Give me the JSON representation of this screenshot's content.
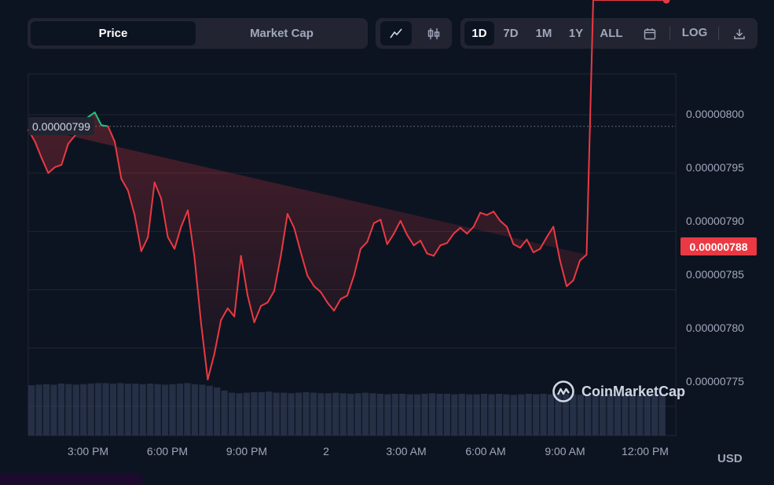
{
  "toolbar": {
    "price_label": "Price",
    "market_cap_label": "Market Cap",
    "line_icon": "line-chart-icon",
    "candle_icon": "candlestick-icon",
    "periods": [
      "1D",
      "7D",
      "1M",
      "1Y",
      "ALL"
    ],
    "active_period": "1D",
    "calendar_icon": "calendar-icon",
    "log_label": "LOG",
    "download_icon": "download-icon"
  },
  "chart_data": {
    "type": "area",
    "x_tick_labels": [
      "3:00 PM",
      "6:00 PM",
      "9:00 PM",
      "2",
      "3:00 AM",
      "6:00 AM",
      "9:00 AM",
      "12:00 PM"
    ],
    "y_tick_labels": [
      "0.00000800",
      "0.00000795",
      "0.00000790",
      "0.00000785",
      "0.00000780",
      "0.00000775"
    ],
    "ylim": [
      7.725e-06,
      8.035e-06
    ],
    "start_price": 7.99e-06,
    "start_price_label": "0.00000799",
    "current_price": 7.88e-06,
    "current_price_label": "0.00000788",
    "currency": "USD",
    "colors": {
      "down": "#ea3943",
      "up": "#16c784",
      "volume": "#3a4564"
    },
    "series": [
      {
        "x_hours": [
          0,
          0.25,
          0.5,
          0.75,
          1,
          1.25,
          1.5,
          1.75,
          2,
          2.25,
          2.5,
          2.75,
          3,
          3.25,
          3.5,
          3.75,
          4,
          4.25,
          4.5,
          4.75,
          5,
          5.25,
          5.5,
          5.75,
          6,
          6.25,
          6.5,
          6.75,
          7,
          7.25,
          7.5,
          7.75,
          8,
          8.25,
          8.5,
          8.75,
          9,
          9.25,
          9.5,
          9.75,
          10,
          10.25,
          10.5,
          10.75,
          11,
          11.25,
          11.5,
          11.75,
          12,
          12.25,
          12.5,
          12.75,
          13,
          13.25,
          13.5,
          13.75,
          14,
          14.25,
          14.5,
          14.75,
          15,
          15.25,
          15.5,
          15.75,
          16,
          16.25,
          16.5,
          16.75,
          17,
          17.25,
          17.5,
          17.75,
          18,
          18.25,
          18.5,
          18.75,
          19,
          19.25,
          19.5,
          19.75,
          20,
          20.25,
          20.5,
          20.75,
          21,
          21.25,
          21.5,
          21.75,
          22,
          22.25,
          22.5,
          22.75,
          23,
          23.25,
          23.5,
          23.75,
          24
        ],
        "values": [
          7.987e-06,
          7.977e-06,
          7.963e-06,
          7.95e-06,
          7.955e-06,
          7.957e-06,
          7.975e-06,
          7.982e-06,
          7.988e-06,
          7.998e-06,
          8.002e-06,
          7.991e-06,
          7.99e-06,
          7.977e-06,
          7.945e-06,
          7.935e-06,
          7.914e-06,
          7.883e-06,
          7.895e-06,
          7.942e-06,
          7.928e-06,
          7.895e-06,
          7.885e-06,
          7.904e-06,
          7.918e-06,
          7.878e-06,
          7.821e-06,
          7.773e-06,
          7.795e-06,
          7.824e-06,
          7.834e-06,
          7.827e-06,
          7.879e-06,
          7.845e-06,
          7.822e-06,
          7.836e-06,
          7.839e-06,
          7.849e-06,
          7.879e-06,
          7.915e-06,
          7.903e-06,
          7.882e-06,
          7.862e-06,
          7.853e-06,
          7.848e-06,
          7.839e-06,
          7.832e-06,
          7.842e-06,
          7.845e-06,
          7.862e-06,
          7.885e-06,
          7.891e-06,
          7.907e-06,
          7.91e-06,
          7.889e-06,
          7.898e-06,
          7.909e-06,
          7.897e-06,
          7.888e-06,
          7.892e-06,
          7.881e-06,
          7.879e-06,
          7.888e-06,
          7.89e-06,
          7.898e-06,
          7.903e-06,
          7.898e-06,
          7.904e-06,
          7.916e-06,
          7.914e-06,
          7.917e-06,
          7.909e-06,
          7.904e-06,
          7.889e-06,
          7.886e-06,
          7.893e-06,
          7.882e-06,
          7.885e-06,
          7.895e-06,
          7.904e-06,
          7.875e-06,
          7.853e-06,
          7.858e-06,
          7.875e-06,
          7.88e-06
        ]
      }
    ],
    "volume_relative": [
      0.94,
      0.95,
      0.96,
      0.95,
      0.97,
      0.96,
      0.95,
      0.96,
      0.97,
      0.98,
      0.98,
      0.97,
      0.98,
      0.97,
      0.97,
      0.96,
      0.97,
      0.96,
      0.95,
      0.96,
      0.97,
      0.98,
      0.96,
      0.95,
      0.93,
      0.9,
      0.84,
      0.8,
      0.79,
      0.8,
      0.81,
      0.81,
      0.82,
      0.8,
      0.8,
      0.79,
      0.8,
      0.81,
      0.8,
      0.79,
      0.79,
      0.8,
      0.79,
      0.78,
      0.79,
      0.8,
      0.79,
      0.78,
      0.77,
      0.78,
      0.78,
      0.77,
      0.77,
      0.78,
      0.79,
      0.78,
      0.78,
      0.77,
      0.78,
      0.77,
      0.77,
      0.78,
      0.77,
      0.78,
      0.77,
      0.76,
      0.77,
      0.78,
      0.77,
      0.78,
      0.77,
      0.78,
      0.78,
      0.77,
      0.76,
      0.77,
      0.78,
      0.77,
      0.78,
      0.77,
      0.78,
      0.77,
      0.76,
      0.77,
      0.78,
      0.77
    ]
  },
  "watermark": {
    "text": "CoinMarketCap",
    "logo_icon": "coinmarketcap-logo-icon"
  }
}
